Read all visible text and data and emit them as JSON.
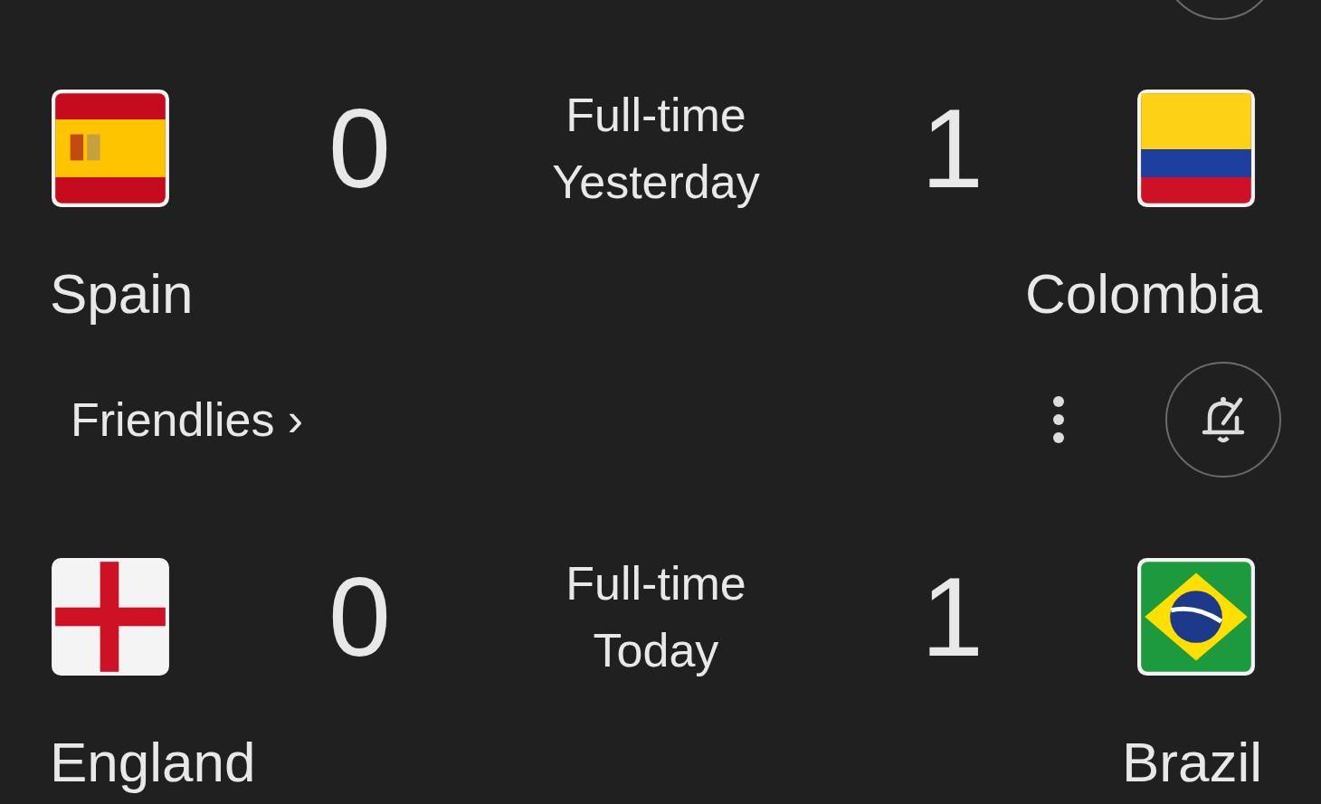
{
  "matches": [
    {
      "home": {
        "name": "Spain",
        "score": "0"
      },
      "away": {
        "name": "Colombia",
        "score": "1"
      },
      "status": "Full-time",
      "date": "Yesterday"
    },
    {
      "competition": "Friendlies ›",
      "home": {
        "name": "England",
        "score": "0"
      },
      "away": {
        "name": "Brazil",
        "score": "1"
      },
      "status": "Full-time",
      "date": "Today"
    }
  ]
}
